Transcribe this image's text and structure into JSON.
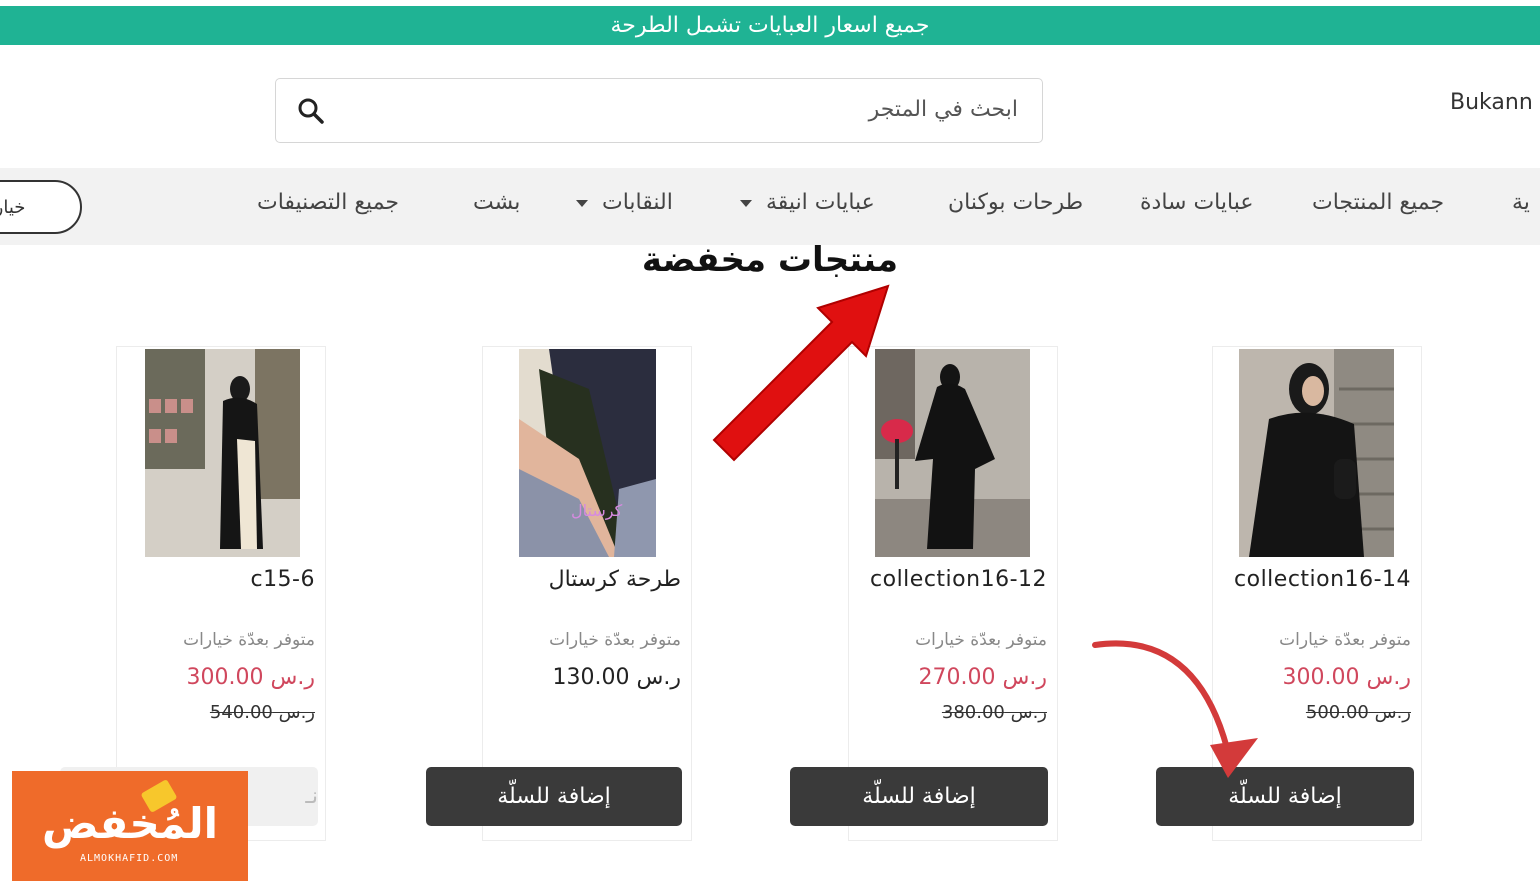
{
  "announcement": "جميع اسعار العبايات تشمل الطرحة",
  "store_name": "Bukann",
  "search": {
    "placeholder": "ابحث في المتجر"
  },
  "nav": {
    "items": [
      {
        "label": "ية"
      },
      {
        "label": "جميع المنتجات"
      },
      {
        "label": "عبايات سادة"
      },
      {
        "label": "طرحات بوكنان"
      },
      {
        "label": "عبايات انيقة"
      },
      {
        "label": "النقابات"
      },
      {
        "label": "بشت"
      },
      {
        "label": "جميع التصنيفات"
      }
    ],
    "options_button": "خيارات ا"
  },
  "section_title": "منتجات مخفضة",
  "products": [
    {
      "name": "collection16-14",
      "availability": "متوفر بعدّة خيارات",
      "price": "ر.س 300.00",
      "old_price": "ر.س 500.00",
      "button": "إضافة للسلّة"
    },
    {
      "name": "collection16-12",
      "availability": "متوفر بعدّة خيارات",
      "price": "ر.س 270.00",
      "old_price": "ر.س 380.00",
      "button": "إضافة للسلّة"
    },
    {
      "name": "طرحة كرستال",
      "availability": "متوفر بعدّة خيارات",
      "price": "ر.س 130.00",
      "old_price": "",
      "button": "إضافة للسلّة",
      "image_caption": "كرستال"
    },
    {
      "name": "c15-6",
      "availability": "متوفر بعدّة خيارات",
      "price": "ر.س 300.00",
      "old_price": "ر.س 540.00",
      "button": "نـ"
    }
  ],
  "watermark": {
    "brand": "المُخفض",
    "domain": "ALMOKHAFID.COM"
  },
  "colors": {
    "accent": "#1fb394",
    "sale_price": "#d0475d",
    "button": "#3a3a3a",
    "watermark": "#ef6b2a",
    "arrow": "#e01010"
  }
}
